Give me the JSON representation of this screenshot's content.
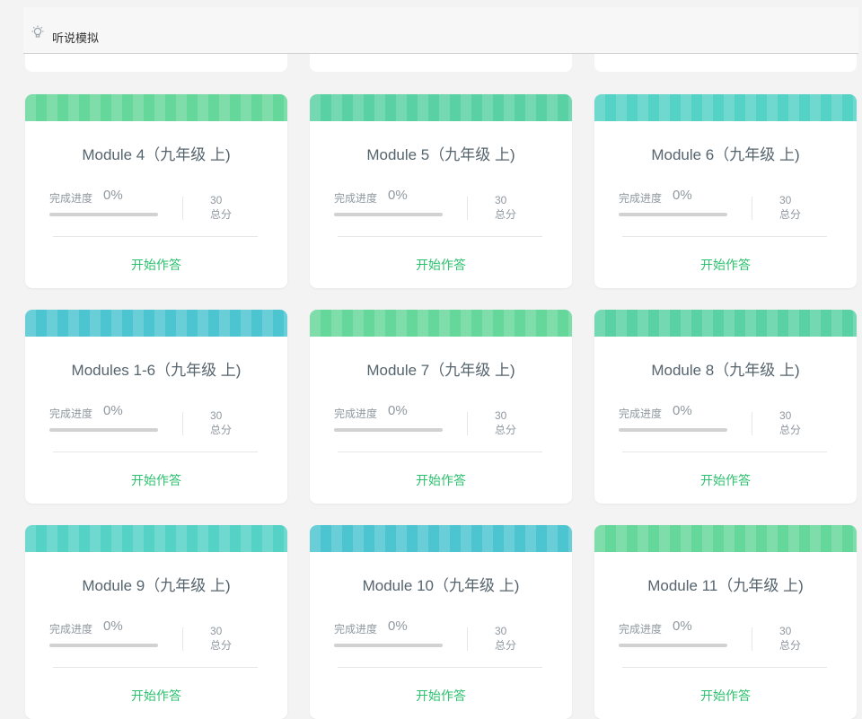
{
  "header": {
    "title": "听说模拟"
  },
  "common": {
    "progress_label": "完成进度",
    "score_label": "总分",
    "start_button": "开始作答"
  },
  "cards": [
    {
      "title": "Module 4（九年级 上)",
      "progress_text": "0%",
      "progress_fraction": 0,
      "score": "30",
      "color": "#66d79a"
    },
    {
      "title": "Module 5（九年级 上)",
      "progress_text": "0%",
      "progress_fraction": 0,
      "score": "30",
      "color": "#59d1a4"
    },
    {
      "title": "Module 6（九年级 上)",
      "progress_text": "0%",
      "progress_fraction": 0,
      "score": "30",
      "color": "#55d2c6"
    },
    {
      "title": "Modules 1-6（九年级 上)",
      "progress_text": "0%",
      "progress_fraction": 0,
      "score": "30",
      "color": "#4cc5d1"
    },
    {
      "title": "Module 7（九年级 上)",
      "progress_text": "0%",
      "progress_fraction": 0,
      "score": "30",
      "color": "#66d79a"
    },
    {
      "title": "Module 8（九年级 上)",
      "progress_text": "0%",
      "progress_fraction": 0,
      "score": "30",
      "color": "#59d1a4"
    },
    {
      "title": "Module 9（九年级 上)",
      "progress_text": "0%",
      "progress_fraction": 0,
      "score": "30",
      "color": "#55d2c6"
    },
    {
      "title": "Module 10（九年级 上)",
      "progress_text": "0%",
      "progress_fraction": 0,
      "score": "30",
      "color": "#4cc5d1"
    },
    {
      "title": "Module 11（九年级 上)",
      "progress_text": "0%",
      "progress_fraction": 0,
      "score": "30",
      "color": "#66d79a"
    }
  ]
}
